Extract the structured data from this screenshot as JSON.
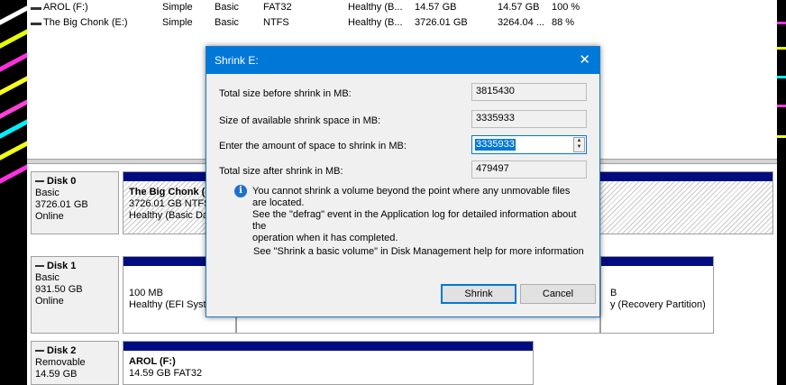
{
  "volume_list": {
    "rows": [
      {
        "name": "AROL (F:)",
        "layout": "Simple",
        "type": "Basic",
        "fs": "FAT32",
        "status": "Healthy (B...",
        "capacity": "14.57 GB",
        "free": "14.57 GB",
        "pct": "100 %"
      },
      {
        "name": "The Big Chonk (E:)",
        "layout": "Simple",
        "type": "Basic",
        "fs": "NTFS",
        "status": "Healthy (B...",
        "capacity": "3726.01 GB",
        "free": "3264.04 ...",
        "pct": "88 %"
      }
    ]
  },
  "disks": [
    {
      "name": "Disk 0",
      "kind": "Basic",
      "size": "3726.01 GB",
      "state": "Online",
      "partitions": [
        {
          "name": "The Big Chonk (",
          "line1": "3726.01 GB NTFS",
          "line2": "Healthy (Basic Da"
        }
      ]
    },
    {
      "name": "Disk 1",
      "kind": "Basic",
      "size": "931.50 GB",
      "state": "Online",
      "partitions": [
        {
          "name": "",
          "line1": "100 MB",
          "line2": "Healthy (EFI Syste"
        },
        {
          "name": "",
          "line1": "B",
          "line2": "y (Recovery Partition)"
        }
      ]
    },
    {
      "name": "Disk 2",
      "kind": "Removable",
      "size": "14.59 GB",
      "state": "",
      "partitions": [
        {
          "name": "AROL (F:)",
          "line1": "14.59 GB FAT32",
          "line2": ""
        }
      ]
    }
  ],
  "dialog": {
    "title": "Shrink E:",
    "close_glyph": "✕",
    "total_before_label": "Total size before shrink in MB:",
    "total_before_value": "3815430",
    "available_label": "Size of available shrink space in MB:",
    "available_value": "3335933",
    "amount_label": "Enter the amount of space to shrink in MB:",
    "amount_value": "3335933",
    "total_after_label": "Total size after shrink in MB:",
    "total_after_value": "479497",
    "info_icon": "i",
    "info_text": "You cannot shrink a volume beyond the point where any unmovable files are located.\nSee the \"defrag\" event in the Application log for detailed information about the\noperation when it has completed.",
    "help_text": "See \"Shrink a basic volume\" in Disk Management help for more information",
    "shrink_label": "Shrink",
    "cancel_label": "Cancel",
    "spin_up": "▲",
    "spin_down": "▼"
  },
  "colors": {
    "title_bar": "#0078d7",
    "partition_bar": "#000d80"
  }
}
